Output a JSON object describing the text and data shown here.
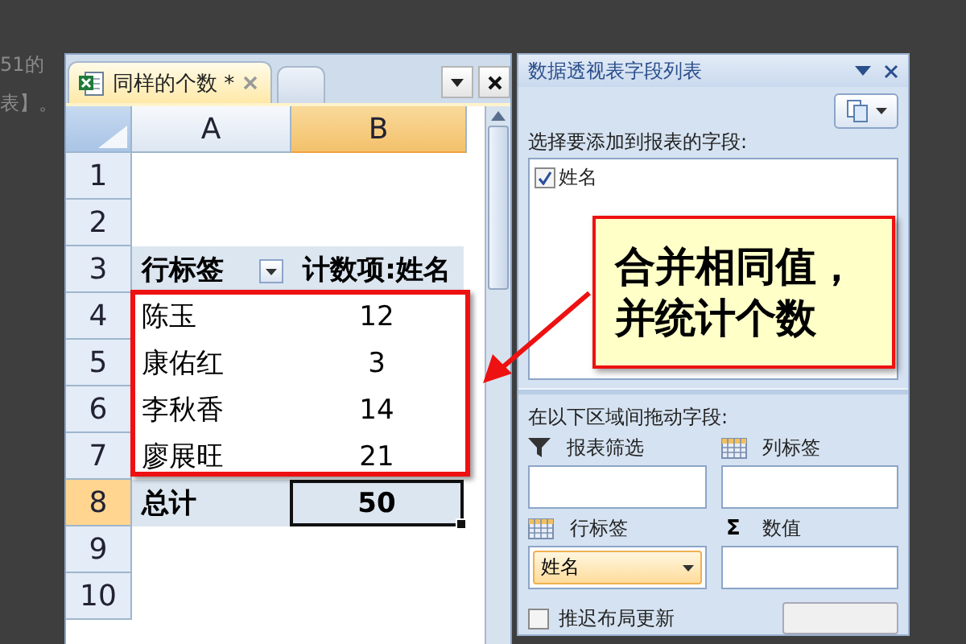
{
  "background_text": [
    "51的",
    "表】。"
  ],
  "workbook": {
    "tabs": [
      {
        "label": "同样的个数 *",
        "selected": true
      }
    ],
    "columns": [
      {
        "label": "A",
        "selected": false
      },
      {
        "label": "B",
        "selected": true
      }
    ],
    "rows": [
      {
        "number": "1",
        "selected": false,
        "kind": "blank"
      },
      {
        "number": "2",
        "selected": false,
        "kind": "blank"
      },
      {
        "number": "3",
        "selected": false,
        "kind": "header",
        "label": "行标签",
        "value": "计数项:姓名"
      },
      {
        "number": "4",
        "selected": false,
        "kind": "item",
        "label": "陈玉",
        "value": "12"
      },
      {
        "number": "5",
        "selected": false,
        "kind": "item",
        "label": "康佑红",
        "value": "3"
      },
      {
        "number": "6",
        "selected": false,
        "kind": "item",
        "label": "李秋香",
        "value": "14"
      },
      {
        "number": "7",
        "selected": false,
        "kind": "item",
        "label": "廖展旺",
        "value": "21"
      },
      {
        "number": "8",
        "selected": true,
        "kind": "total",
        "label": "总计",
        "value": "50"
      },
      {
        "number": "9",
        "selected": false,
        "kind": "blank"
      },
      {
        "number": "10",
        "selected": false,
        "kind": "blank"
      }
    ]
  },
  "callout": {
    "lines": [
      "合并相同值，",
      "并统计个数"
    ]
  },
  "pivot_panel": {
    "title": "数据透视表字段列表",
    "field_prompt": "选择要添加到报表的字段:",
    "fields": [
      {
        "label": "姓名",
        "checked": true
      }
    ],
    "areas_prompt": "在以下区域间拖动字段:",
    "areas": [
      {
        "kind": "filter",
        "label": "报表筛选"
      },
      {
        "kind": "columns",
        "label": "列标签"
      },
      {
        "kind": "rows",
        "label": "行标签",
        "items": [
          "姓名"
        ]
      },
      {
        "kind": "values",
        "label": "数值",
        "symbol": "Σ"
      }
    ],
    "defer_update": {
      "label": "推迟布局更新",
      "checked": false
    }
  }
}
